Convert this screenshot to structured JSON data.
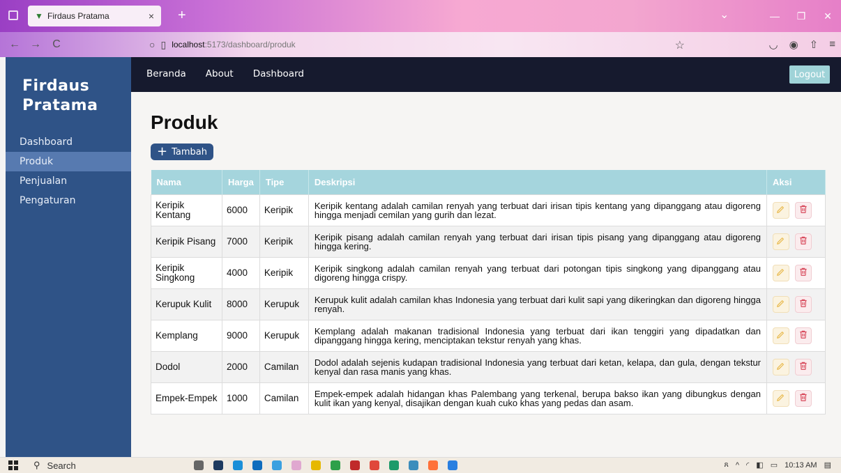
{
  "browser": {
    "tab_title": "Firdaus Pratama",
    "tab_close": "×",
    "new_tab": "+",
    "url_host": "localhost",
    "url_path": ":5173/dashboard/produk",
    "back": "←",
    "forward": "→",
    "reload": "C",
    "colors": {
      "accent": "#2f5387"
    }
  },
  "sidebar": {
    "brand_line1": "Firdaus",
    "brand_line2": "Pratama",
    "items": [
      {
        "label": "Dashboard"
      },
      {
        "label": "Produk"
      },
      {
        "label": "Penjualan"
      },
      {
        "label": "Pengaturan"
      }
    ]
  },
  "topnav": {
    "links": [
      {
        "label": "Beranda"
      },
      {
        "label": "About"
      },
      {
        "label": "Dashboard"
      }
    ],
    "logout_label": "Logout"
  },
  "main": {
    "title": "Produk",
    "add_label": "Tambah",
    "table": {
      "headers": [
        "Nama",
        "Harga",
        "Tipe",
        "Deskripsi",
        "Aksi"
      ],
      "rows": [
        {
          "nama": "Keripik Kentang",
          "harga": "6000",
          "tipe": "Keripik",
          "deskripsi": "Keripik kentang adalah camilan renyah yang terbuat dari irisan tipis kentang yang dipanggang atau digoreng hingga menjadi cemilan yang gurih dan lezat."
        },
        {
          "nama": "Keripik Pisang",
          "harga": "7000",
          "tipe": "Keripik",
          "deskripsi": "Keripik pisang adalah camilan renyah yang terbuat dari irisan tipis pisang yang dipanggang atau digoreng hingga kering."
        },
        {
          "nama": "Keripik Singkong",
          "harga": "4000",
          "tipe": "Keripik",
          "deskripsi": "Keripik singkong adalah camilan renyah yang terbuat dari potongan tipis singkong yang dipanggang atau digoreng hingga crispy."
        },
        {
          "nama": "Kerupuk Kulit",
          "harga": "8000",
          "tipe": "Kerupuk",
          "deskripsi": "Kerupuk kulit adalah camilan khas Indonesia yang terbuat dari kulit sapi yang dikeringkan dan digoreng hingga renyah."
        },
        {
          "nama": "Kemplang",
          "harga": "9000",
          "tipe": "Kerupuk",
          "deskripsi": "Kemplang adalah makanan tradisional Indonesia yang terbuat dari ikan tenggiri yang dipadatkan dan dipanggang hingga kering, menciptakan tekstur renyah yang khas."
        },
        {
          "nama": "Dodol",
          "harga": "2000",
          "tipe": "Camilan",
          "deskripsi": "Dodol adalah sejenis kudapan tradisional Indonesia yang terbuat dari ketan, kelapa, dan gula, dengan tekstur kenyal dan rasa manis yang khas."
        },
        {
          "nama": "Empek-Empek",
          "harga": "1000",
          "tipe": "Camilan",
          "deskripsi": "Empek-empek adalah hidangan khas Palembang yang terkenal, berupa bakso ikan yang dibungkus dengan kulit ikan yang kenyal, disajikan dengan kuah cuko khas yang pedas dan asam."
        }
      ]
    }
  },
  "taskbar": {
    "search_label": "Search",
    "time": "10:13 AM"
  }
}
